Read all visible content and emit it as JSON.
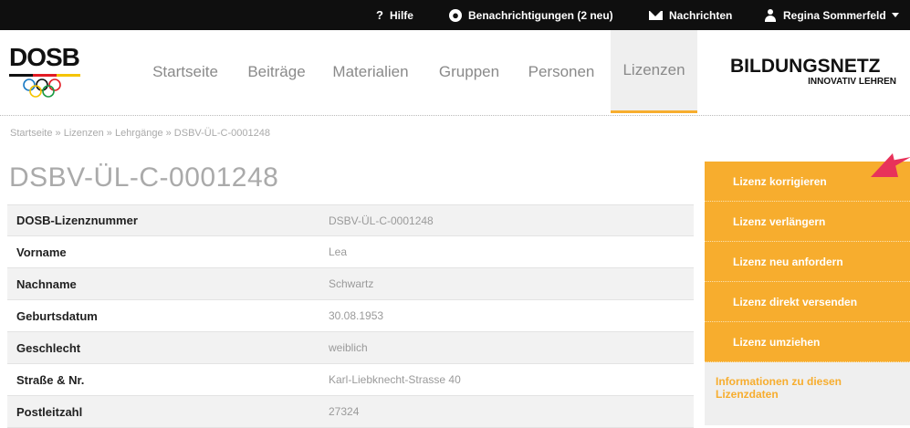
{
  "topbar": {
    "help": "Hilfe",
    "notifications": "Benachrichtigungen (2 neu)",
    "messages": "Nachrichten",
    "user": "Regina Sommerfeld",
    "icons": [
      "question-icon",
      "globe-icon",
      "mail-icon",
      "user-icon",
      "caret-down-icon"
    ]
  },
  "logo": {
    "text": "DOSB"
  },
  "nav": {
    "items": [
      {
        "label": "Startseite"
      },
      {
        "label": "Beiträge"
      },
      {
        "label": "Materialien"
      },
      {
        "label": "Gruppen"
      },
      {
        "label": "Personen"
      },
      {
        "label": "Lizenzen"
      }
    ],
    "active": "Lizenzen"
  },
  "brand": {
    "title": "BILDUNGSNETZ",
    "subtitle": "INNOVATIV LEHREN"
  },
  "breadcrumb": "Startseite » Lizenzen » Lehrgänge » DSBV-ÜL-C-0001248",
  "page_title": "DSBV-ÜL-C-0001248",
  "table": {
    "rows": [
      {
        "label": "DOSB-Lizenznummer",
        "value": "DSBV-ÜL-C-0001248"
      },
      {
        "label": "Vorname",
        "value": "Lea"
      },
      {
        "label": "Nachname",
        "value": "Schwartz"
      },
      {
        "label": "Geburtsdatum",
        "value": "30.08.1953"
      },
      {
        "label": "Geschlecht",
        "value": "weiblich"
      },
      {
        "label": "Straße & Nr.",
        "value": "Karl-Liebknecht-Strasse 40"
      },
      {
        "label": "Postleitzahl",
        "value": "27324"
      }
    ]
  },
  "sidebar": {
    "buttons": [
      {
        "label": "Lizenz korrigieren"
      },
      {
        "label": "Lizenz verlängern"
      },
      {
        "label": "Lizenz neu anfordern"
      },
      {
        "label": "Lizenz direkt versenden"
      },
      {
        "label": "Lizenz umziehen"
      }
    ],
    "info": "Informationen zu diesen Lizenzdaten"
  },
  "colors": {
    "accent": "#f7ad2e",
    "topbar": "#0f0f0f",
    "arrow": "#e8325a"
  }
}
